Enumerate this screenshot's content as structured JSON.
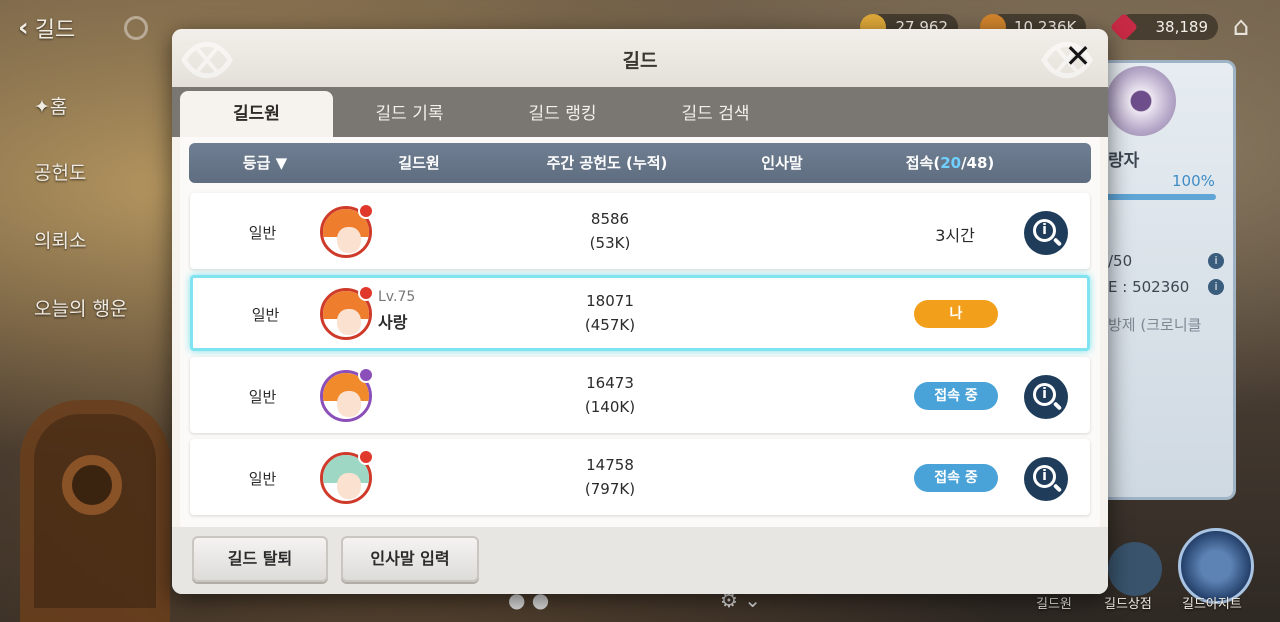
{
  "topbar": {
    "back_label": "길드",
    "currencies": [
      {
        "name": "coin-gold",
        "value": "27,962",
        "color": "#e0a93a"
      },
      {
        "name": "coin-bronze",
        "value": "10,236K",
        "color": "#d2852c"
      },
      {
        "name": "gem-red",
        "value": "38,189",
        "color": "#c72a45"
      }
    ]
  },
  "side_menu": {
    "items": [
      "홈",
      "공헌도",
      "의뢰소",
      "오늘의 행운"
    ]
  },
  "right_panel": {
    "title_partial": "랑자",
    "progress_label": "100%",
    "members_partial": "/50",
    "exp_partial": "E : 502360",
    "notice_partial": "방제 (크로니클"
  },
  "bottom_right": {
    "labels": [
      "길드원",
      "길드상점",
      "길드아지트"
    ]
  },
  "modal": {
    "title": "길드",
    "tabs": [
      "길드원",
      "길드 기록",
      "길드 랭킹",
      "길드 검색"
    ],
    "columns": {
      "rank": "등급",
      "member": "길드원",
      "contribution": "주간 공헌도 (누적)",
      "greeting": "인사말",
      "login_prefix": "접속(",
      "login_online": "20",
      "login_suffix": "/48)"
    },
    "rows": [
      {
        "rank": "일반",
        "level": "",
        "name": "",
        "weekly": "8586",
        "total": "(53K)",
        "status": "3시간",
        "status_type": "text",
        "avatar_hair": "#ef7d2e",
        "badge": true
      },
      {
        "rank": "일반",
        "level": "Lv.75",
        "name": "사랑",
        "weekly": "18071",
        "total": "(457K)",
        "status": "나",
        "status_type": "me",
        "avatar_hair": "#ef7d2e",
        "badge": true
      },
      {
        "rank": "일반",
        "level": "",
        "name": "",
        "weekly": "16473",
        "total": "(140K)",
        "status": "접속 중",
        "status_type": "online",
        "avatar_hair": "#f08a2a",
        "badge": true
      },
      {
        "rank": "일반",
        "level": "",
        "name": "",
        "weekly": "14758",
        "total": "(797K)",
        "status": "접속 중",
        "status_type": "online",
        "avatar_hair": "#9fd7c5",
        "badge": true
      }
    ],
    "footer": {
      "leave_label": "길드 탈퇴",
      "greeting_label": "인사말 입력"
    }
  }
}
